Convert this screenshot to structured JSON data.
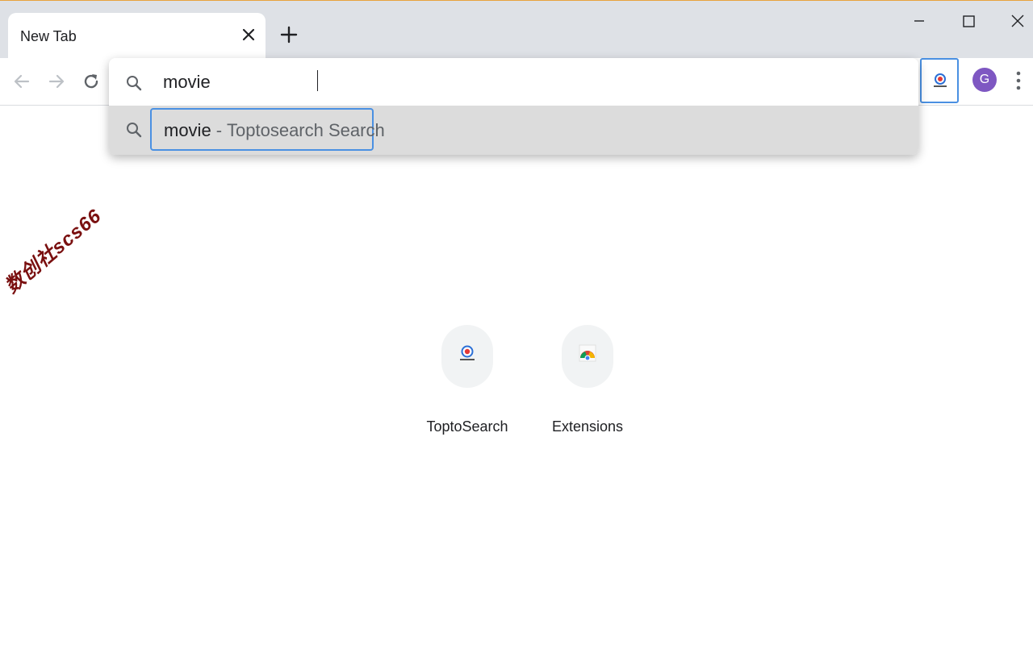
{
  "tab": {
    "title": "New Tab"
  },
  "omnibox": {
    "query": "movie",
    "suggestion": {
      "query": "movie",
      "separator": "-",
      "engine_text": "Toptosearch Search"
    }
  },
  "profile": {
    "initial": "G"
  },
  "shortcuts": [
    {
      "label": "ToptoSearch",
      "icon": "toptosearch-logo-icon"
    },
    {
      "label": "Extensions",
      "icon": "chrome-extensions-icon"
    }
  ],
  "watermark": {
    "text": "数创社scs66"
  },
  "colors": {
    "tabstrip": "#dee1e6",
    "accent_focus": "#4a90e2",
    "avatar": "#7e57c2",
    "suggestion_bg": "#dcdcdc",
    "watermark": "#7a1010"
  }
}
